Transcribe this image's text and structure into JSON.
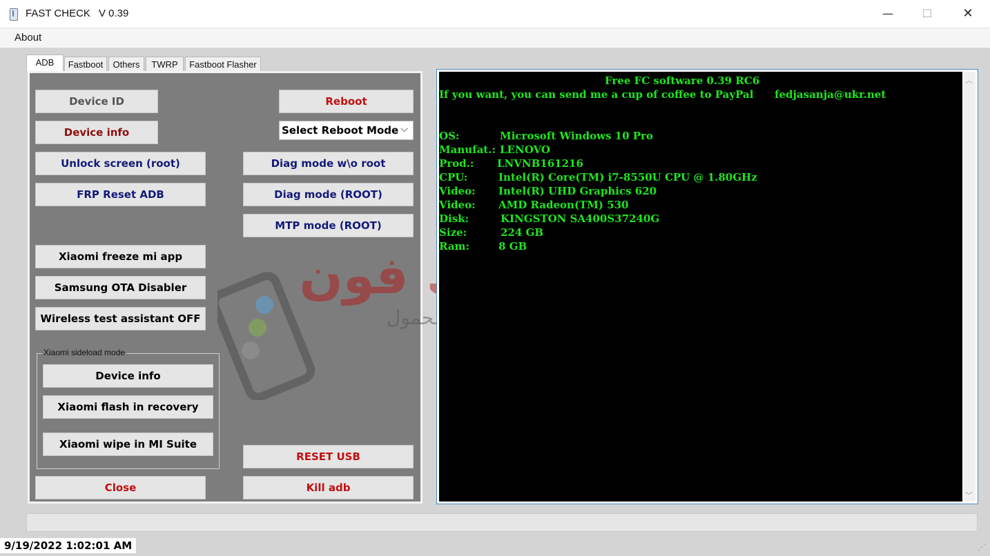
{
  "window": {
    "title": "FAST CHECK",
    "version": "V 0.39"
  },
  "menu": {
    "about": "About"
  },
  "tabs": [
    "ADB",
    "Fastboot",
    "Others",
    "TWRP",
    "Fastboot Flasher"
  ],
  "adb": {
    "device_id": "Device ID",
    "reboot": "Reboot",
    "device_info": "Device info",
    "reboot_mode_select": "Select Reboot Mode",
    "unlock_screen": "Unlock screen (root)",
    "diag_wo_root": "Diag mode w\\o root",
    "frp_reset": "FRP Reset ADB",
    "diag_root": "Diag mode (ROOT)",
    "mtp_root": "MTP mode (ROOT)",
    "xiaomi_freeze": "Xiaomi freeze mi app",
    "samsung_ota": "Samsung OTA Disabler",
    "wireless_off": "Wireless test assistant OFF",
    "sideload_group": "Xiaomi sideload mode",
    "sideload_device_info": "Device info",
    "xiaomi_flash": "Xiaomi flash in recovery",
    "xiaomi_wipe": "Xiaomi wipe in MI Suite",
    "reset_usb": "RESET USB",
    "close": "Close",
    "kill_adb": "Kill adb"
  },
  "console": {
    "header": "Free FC software 0.39 RC6",
    "coffee": "If you want, you can send me a cup of coffee to PayPal",
    "email": "fedjasanja@ukr.net",
    "rows": [
      {
        "label": "OS:",
        "value": "Microsoft Windows 10 Pro"
      },
      {
        "label": "Manufat.:",
        "value": "LENOVO"
      },
      {
        "label": "Prod.:",
        "value": "LNVNB161216"
      },
      {
        "label": "CPU:",
        "value": "Intel(R) Core(TM) i7-8550U CPU @ 1.80GHz"
      },
      {
        "label": "Video:",
        "value": "Intel(R) UHD Graphics 620"
      },
      {
        "label": "Video:",
        "value": "AMD Radeon(TM) 530"
      },
      {
        "label": "Disk:",
        "value": "KINGSTON SA400S37240G"
      },
      {
        "label": "Size:",
        "value": "224 GB"
      },
      {
        "label": "Ram:",
        "value": "8 GB"
      }
    ]
  },
  "watermark": {
    "line1": "تيتانك فون",
    "line2": "لخدمات الهاتف المحمول"
  },
  "status": {
    "datetime": "9/19/2022 1:02:01 AM"
  },
  "colors": {
    "console_bg": "#000000",
    "console_text": "#1ee61e",
    "panel_bg": "#7d7d7d",
    "accent_red": "#c01010",
    "accent_navy": "#141a78"
  }
}
